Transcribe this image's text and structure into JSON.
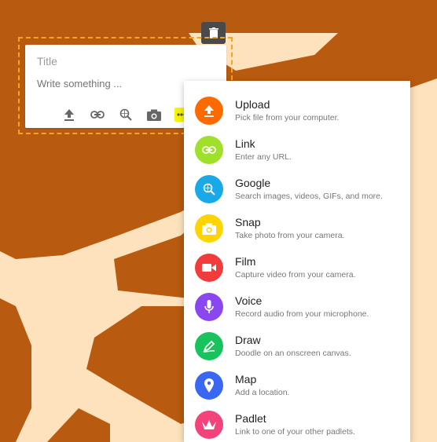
{
  "note": {
    "title_placeholder": "Title",
    "body_placeholder": "Write something ..."
  },
  "menu": {
    "items": [
      {
        "label": "Upload",
        "desc": "Pick file from your computer.",
        "color": "#ff6a00",
        "icon": "upload-icon"
      },
      {
        "label": "Link",
        "desc": "Enter any URL.",
        "color": "#9ee02a",
        "icon": "link-icon"
      },
      {
        "label": "Google",
        "desc": "Search images, videos, GIFs, and more.",
        "color": "#19a9e8",
        "icon": "google-search-icon"
      },
      {
        "label": "Snap",
        "desc": "Take photo from your camera.",
        "color": "#ffd400",
        "icon": "camera-icon"
      },
      {
        "label": "Film",
        "desc": "Capture video from your camera.",
        "color": "#f23c3c",
        "icon": "video-camera-icon"
      },
      {
        "label": "Voice",
        "desc": "Record audio from your microphone.",
        "color": "#8a47f0",
        "icon": "microphone-icon"
      },
      {
        "label": "Draw",
        "desc": "Doodle on an onscreen canvas.",
        "color": "#18c25c",
        "icon": "draw-icon"
      },
      {
        "label": "Map",
        "desc": "Add a location.",
        "color": "#3a67f2",
        "icon": "map-pin-icon"
      },
      {
        "label": "Padlet",
        "desc": "Link to one of your other padlets.",
        "color": "#f2447a",
        "icon": "padlet-icon"
      }
    ]
  },
  "colors": {
    "background": "#fde2bd",
    "pattern": "#b85a0f",
    "selection_outline": "#f3a51b"
  }
}
